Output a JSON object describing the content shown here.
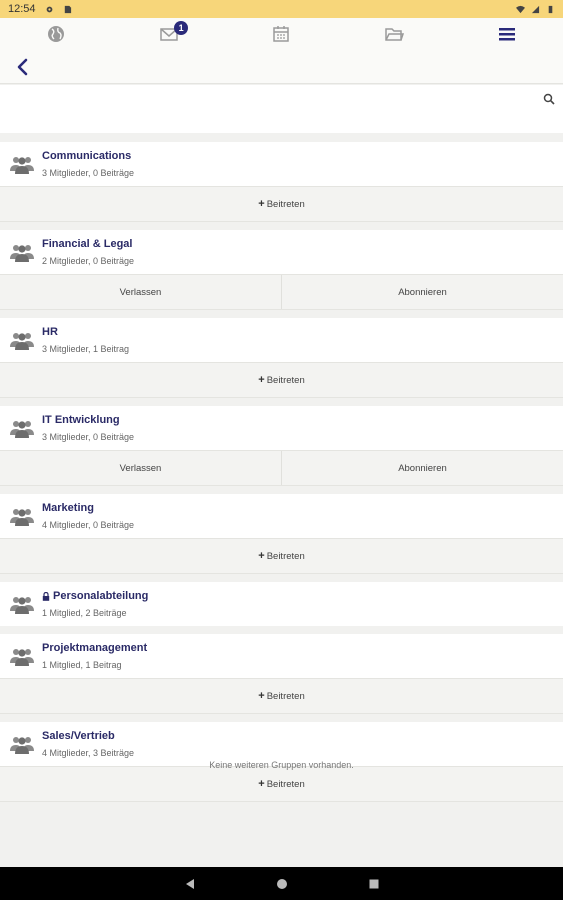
{
  "status": {
    "time": "12:54"
  },
  "topnav": {
    "items": [
      {
        "icon": "globe-icon"
      },
      {
        "icon": "mail-icon",
        "badge": "1"
      },
      {
        "icon": "calendar-icon"
      },
      {
        "icon": "folder-icon"
      },
      {
        "icon": "menu-icon"
      }
    ],
    "accent": "#2a2a7a"
  },
  "search": {
    "placeholder": "",
    "value": ""
  },
  "groups": [
    {
      "name": "Communications",
      "meta": "3 Mitglieder, 0 Beiträge",
      "locked": false,
      "actions": [
        "Beitreten"
      ]
    },
    {
      "name": "Financial & Legal",
      "meta": "2 Mitglieder, 0 Beiträge",
      "locked": false,
      "actions": [
        "Verlassen",
        "Abonnieren"
      ]
    },
    {
      "name": "HR",
      "meta": "3 Mitglieder, 1 Beitrag",
      "locked": false,
      "actions": [
        "Beitreten"
      ]
    },
    {
      "name": "IT Entwicklung",
      "meta": "3 Mitglieder, 0 Beiträge",
      "locked": false,
      "actions": [
        "Verlassen",
        "Abonnieren"
      ]
    },
    {
      "name": "Marketing",
      "meta": "4 Mitglieder, 0 Beiträge",
      "locked": false,
      "actions": [
        "Beitreten"
      ]
    },
    {
      "name": "Personalabteilung",
      "meta": "1 Mitglied, 2 Beiträge",
      "locked": true,
      "actions": []
    },
    {
      "name": "Projektmanagement",
      "meta": "1 Mitglied, 1 Beitrag",
      "locked": false,
      "actions": [
        "Beitreten"
      ]
    },
    {
      "name": "Sales/Vertrieb",
      "meta": "4 Mitglieder, 3 Beiträge",
      "locked": false,
      "actions": [
        "Beitreten"
      ]
    }
  ],
  "footer": {
    "message": "Keine weiteren Gruppen vorhanden."
  }
}
